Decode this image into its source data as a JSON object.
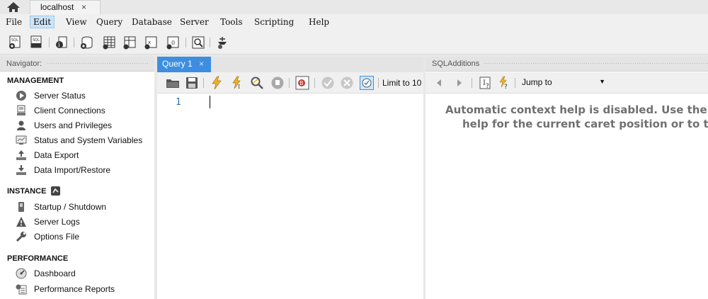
{
  "connection_tab": {
    "label": "localhost",
    "close": "×"
  },
  "menu": [
    "File",
    "Edit",
    "View",
    "Query",
    "Database",
    "Server",
    "Tools",
    "Scripting",
    "Help"
  ],
  "toolbar_icons": [
    "new-sql-tab-icon",
    "open-sql-script-icon",
    "inspect-object-icon",
    "create-schema-icon",
    "create-table-icon",
    "create-view-icon",
    "create-procedure-icon",
    "create-function-icon",
    "search-table-data-icon",
    "reconnect-icon"
  ],
  "navigator": {
    "title": "Navigator:",
    "sections": [
      {
        "title": "MANAGEMENT",
        "items": [
          "Server Status",
          "Client Connections",
          "Users and Privileges",
          "Status and System Variables",
          "Data Export",
          "Data Import/Restore"
        ]
      },
      {
        "title": "INSTANCE",
        "items": [
          "Startup / Shutdown",
          "Server Logs",
          "Options File"
        ]
      },
      {
        "title": "PERFORMANCE",
        "items": [
          "Dashboard",
          "Performance Reports"
        ]
      }
    ]
  },
  "query": {
    "tab_label": "Query 1",
    "tab_close": "×",
    "limit_label": "Limit to 10",
    "line_number": "1"
  },
  "sql_additions": {
    "title": "SQLAdditions",
    "jump_to": "Jump to",
    "help_line1": "Automatic context help is disabled. Use the",
    "help_line2": "help for the current caret position or to t"
  },
  "colors": {
    "accent": "#3d8ee0",
    "help_text": "#707070",
    "line_number": "#3070b0"
  }
}
